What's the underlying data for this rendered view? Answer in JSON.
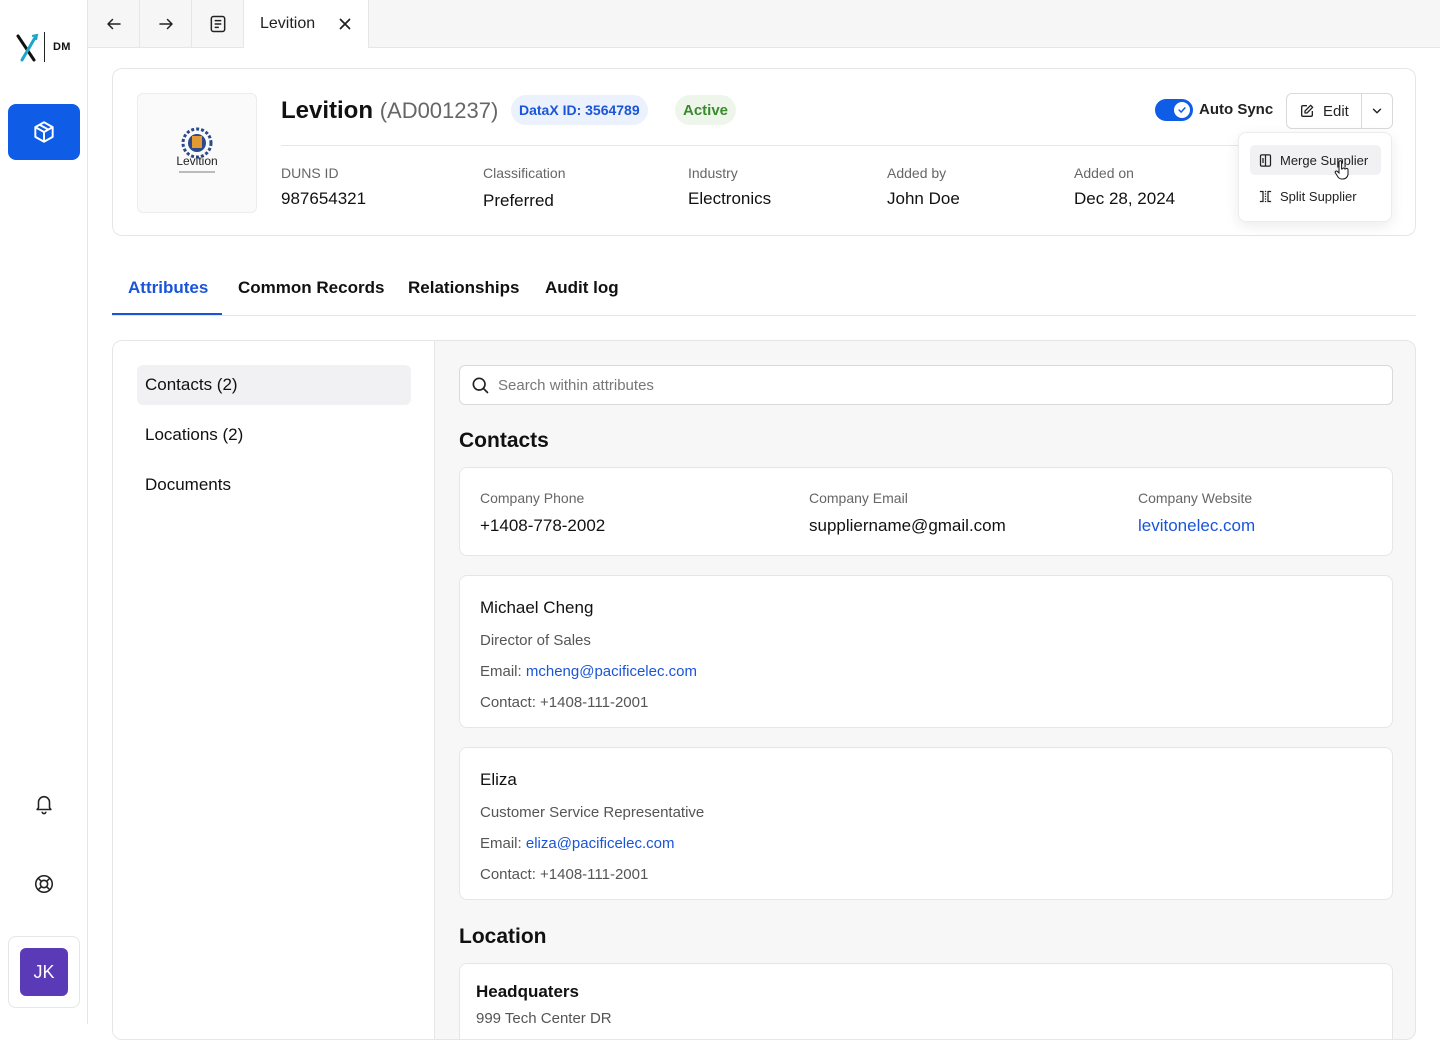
{
  "brand": {
    "logo_text": "DM"
  },
  "nav": {
    "active_icon": "cube-icon",
    "bell_icon": "bell-icon",
    "help_icon": "lifebuoy-icon"
  },
  "user": {
    "initials": "JK"
  },
  "topbar": {
    "tab_title": "Levition"
  },
  "supplier": {
    "name": "Levition",
    "code": "(AD001237)",
    "datax_id": "DataX ID: 3564789",
    "status": "Active",
    "logo_text": "Levition",
    "meta": [
      {
        "label": "DUNS ID",
        "value": "987654321"
      },
      {
        "label": "Classification",
        "value": "Preferred"
      },
      {
        "label": "Industry",
        "value": "Electronics"
      },
      {
        "label": "Added by",
        "value": "John Doe"
      },
      {
        "label": "Added on",
        "value": "Dec 28, 2024"
      }
    ],
    "auto_sync_label": "Auto Sync",
    "auto_sync_on": true,
    "edit_label": "Edit"
  },
  "dropdown": {
    "items": [
      {
        "label": "Merge Supplier",
        "icon": "merge-icon"
      },
      {
        "label": "Split Supplier",
        "icon": "split-icon"
      }
    ]
  },
  "tabs": [
    {
      "label": "Attributes",
      "active": true
    },
    {
      "label": "Common Records"
    },
    {
      "label": "Relationships"
    },
    {
      "label": "Audit log"
    }
  ],
  "sidebar": {
    "items": [
      {
        "label": "Contacts (2)",
        "selected": true
      },
      {
        "label": "Locations (2)"
      },
      {
        "label": "Documents"
      }
    ]
  },
  "search": {
    "placeholder": "Search within attributes",
    "value": ""
  },
  "contacts": {
    "title": "Contacts",
    "company": [
      {
        "label": "Company Phone",
        "value": "+1408-778-2002"
      },
      {
        "label": "Company Email",
        "value": "suppliername@gmail.com"
      },
      {
        "label": "Company Website",
        "value": "levitonelec.com"
      }
    ],
    "people": [
      {
        "name": "Michael Cheng",
        "role": "Director of Sales",
        "email_label": "Email:",
        "email": "mcheng@pacificelec.com",
        "contact": "Contact: +1408-111-2001"
      },
      {
        "name": "Eliza",
        "role": "Customer Service Representative",
        "email_label": "Email:",
        "email": "eliza@pacificelec.com",
        "contact": "Contact: +1408-111-2001"
      }
    ]
  },
  "location": {
    "title": "Location",
    "items": [
      {
        "name": "Headquaters",
        "address": "999 Tech Center DR"
      }
    ]
  },
  "colors": {
    "accent": "#1a55d8",
    "nav_active": "#0f5ce6",
    "avatar": "#5b3ab8",
    "active_green": "#3a8a2e"
  }
}
